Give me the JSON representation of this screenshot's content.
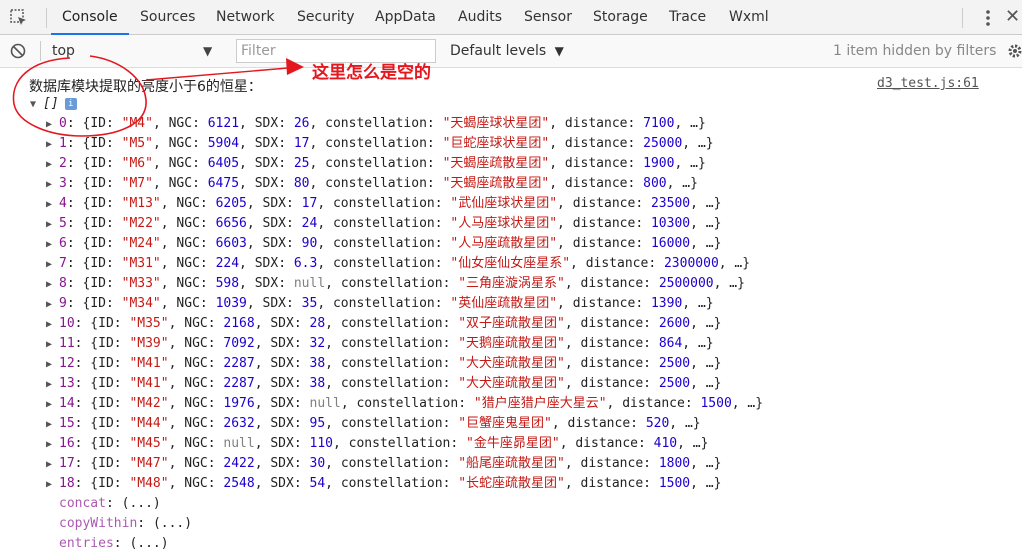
{
  "tabs": [
    "Console",
    "Sources",
    "Network",
    "Security",
    "AppData",
    "Audits",
    "Sensor",
    "Storage",
    "Trace",
    "Wxml"
  ],
  "active_tab": "Console",
  "toolbar": {
    "context": "top",
    "filter_placeholder": "Filter",
    "levels": "Default levels",
    "hidden_info": "1 item hidden by filters"
  },
  "console": {
    "message": "数据库模块提取的亮度小于6的恒星：",
    "source": "d3_test.js:61",
    "array_label": "[]",
    "info_badge": "i",
    "annotation": "这里怎么是空的",
    "rows": [
      {
        "i": "0",
        "id": "\"M4\"",
        "ngc": "6121",
        "sdx": "26",
        "con": "\"天蝎座球状星团\"",
        "dist": "7100"
      },
      {
        "i": "1",
        "id": "\"M5\"",
        "ngc": "5904",
        "sdx": "17",
        "con": "\"巨蛇座球状星团\"",
        "dist": "25000"
      },
      {
        "i": "2",
        "id": "\"M6\"",
        "ngc": "6405",
        "sdx": "25",
        "con": "\"天蝎座疏散星团\"",
        "dist": "1900"
      },
      {
        "i": "3",
        "id": "\"M7\"",
        "ngc": "6475",
        "sdx": "80",
        "con": "\"天蝎座疏散星团\"",
        "dist": "800"
      },
      {
        "i": "4",
        "id": "\"M13\"",
        "ngc": "6205",
        "sdx": "17",
        "con": "\"武仙座球状星团\"",
        "dist": "23500"
      },
      {
        "i": "5",
        "id": "\"M22\"",
        "ngc": "6656",
        "sdx": "24",
        "con": "\"人马座球状星团\"",
        "dist": "10300"
      },
      {
        "i": "6",
        "id": "\"M24\"",
        "ngc": "6603",
        "sdx": "90",
        "con": "\"人马座疏散星团\"",
        "dist": "16000"
      },
      {
        "i": "7",
        "id": "\"M31\"",
        "ngc": "224",
        "sdx": "6.3",
        "con": "\"仙女座仙女座星系\"",
        "dist": "2300000"
      },
      {
        "i": "8",
        "id": "\"M33\"",
        "ngc": "598",
        "sdx": "null",
        "con": "\"三角座漩涡星系\"",
        "dist": "2500000"
      },
      {
        "i": "9",
        "id": "\"M34\"",
        "ngc": "1039",
        "sdx": "35",
        "con": "\"英仙座疏散星团\"",
        "dist": "1390"
      },
      {
        "i": "10",
        "id": "\"M35\"",
        "ngc": "2168",
        "sdx": "28",
        "con": "\"双子座疏散星团\"",
        "dist": "2600"
      },
      {
        "i": "11",
        "id": "\"M39\"",
        "ngc": "7092",
        "sdx": "32",
        "con": "\"天鹅座疏散星团\"",
        "dist": "864"
      },
      {
        "i": "12",
        "id": "\"M41\"",
        "ngc": "2287",
        "sdx": "38",
        "con": "\"大犬座疏散星团\"",
        "dist": "2500"
      },
      {
        "i": "13",
        "id": "\"M41\"",
        "ngc": "2287",
        "sdx": "38",
        "con": "\"大犬座疏散星团\"",
        "dist": "2500"
      },
      {
        "i": "14",
        "id": "\"M42\"",
        "ngc": "1976",
        "sdx": "null",
        "con": "\"猎户座猎户座大星云\"",
        "dist": "1500"
      },
      {
        "i": "15",
        "id": "\"M44\"",
        "ngc": "2632",
        "sdx": "95",
        "con": "\"巨蟹座鬼星团\"",
        "dist": "520"
      },
      {
        "i": "16",
        "id": "\"M45\"",
        "ngc": "null",
        "sdx": "110",
        "con": "\"金牛座昴星团\"",
        "dist": "410"
      },
      {
        "i": "17",
        "id": "\"M47\"",
        "ngc": "2422",
        "sdx": "30",
        "con": "\"船尾座疏散星团\"",
        "dist": "1800"
      },
      {
        "i": "18",
        "id": "\"M48\"",
        "ngc": "2548",
        "sdx": "54",
        "con": "\"长蛇座疏散星团\"",
        "dist": "1500"
      }
    ],
    "methods": [
      {
        "name": "concat",
        "value": "(...)"
      },
      {
        "name": "copyWithin",
        "value": "(...)"
      },
      {
        "name": "entries",
        "value": "(...)"
      }
    ]
  },
  "icons": {
    "inspect": "inspect-element-icon",
    "device": "device-toggle-icon",
    "clear": "clear-console-icon",
    "settings": "gear-icon",
    "more": "kebab-menu-icon",
    "close": "close-icon"
  },
  "colors": {
    "accent": "#1a73e8",
    "string": "#c41a16",
    "number": "#1c00cf",
    "annotation": "#e4171f"
  }
}
